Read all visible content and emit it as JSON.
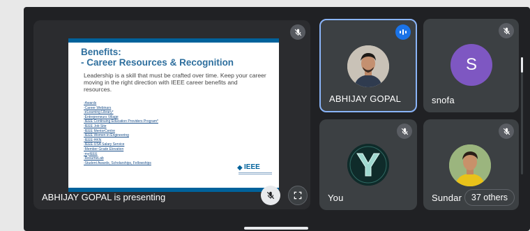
{
  "presentation": {
    "slide": {
      "title_line1": "Benefits:",
      "title_line2": "- Career Resources & Recognition",
      "body": "Leadership is a skill that must be crafted over time. Keep your career moving in the right direction with IEEE career benefits and resources.",
      "links": [
        "-Awards",
        "-Career Webinars",
        "-eLearning Library*",
        "-Entrepreneurs Village",
        "-IEEE Continuing Education Providers Program*",
        "-IEEE Job Site",
        "-IEEE MentorCentre",
        "-IEEE Women in Engineering",
        "-IEEE-HKN",
        "-IEEE-USA Salary Service",
        "-Member Grade Elevation",
        "-myIEEE",
        "-ResumeLab",
        "-Student Awards, Scholarships, Fellowships"
      ],
      "logo_text": "IEEE"
    },
    "presenter_label": "ABHIJAY GOPAL is presenting"
  },
  "participants": [
    {
      "name": "ABHIJAY GOPAL",
      "status": "speaking"
    },
    {
      "name": "snofa",
      "initial": "S",
      "status": "muted",
      "avatar_color": "#7e57c2"
    },
    {
      "name": "You",
      "status": "muted"
    },
    {
      "name": "Sundar",
      "status": "muted"
    }
  ],
  "others": {
    "label": "37 others"
  },
  "colors": {
    "accent": "#8ab4f8",
    "tile_bg": "#3c4043",
    "screen_bg": "#202124",
    "speaking": "#1a73e8"
  }
}
